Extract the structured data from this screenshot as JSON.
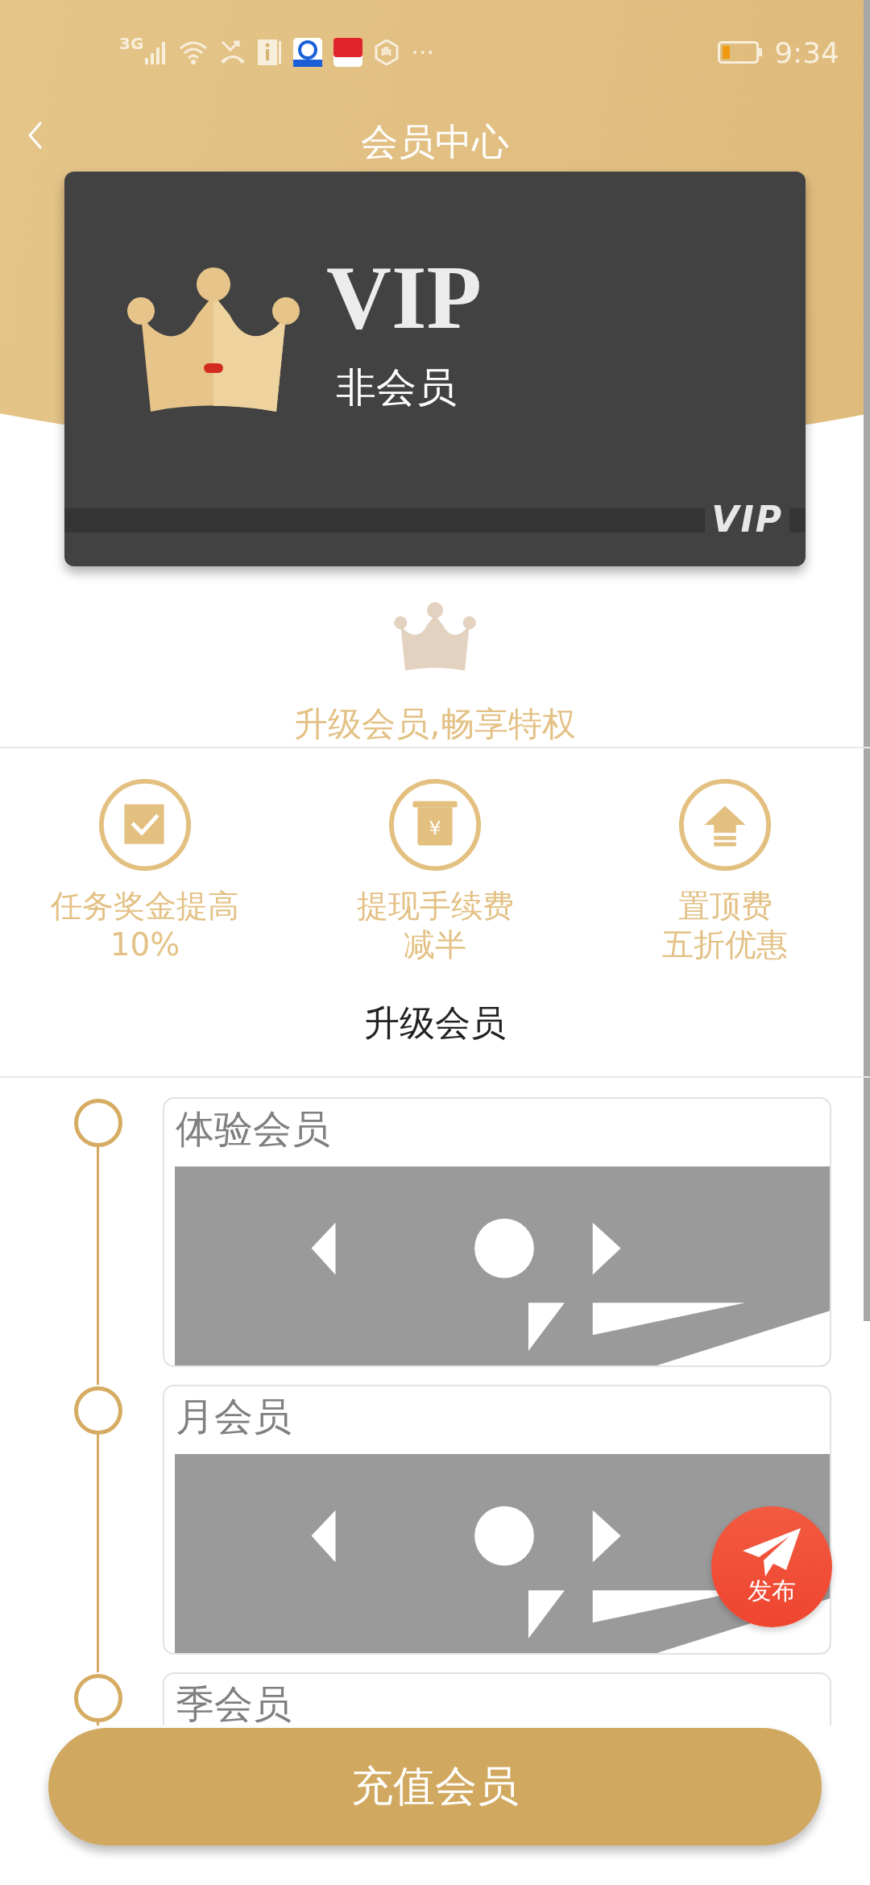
{
  "status_bar": {
    "network": "3G",
    "more": "···",
    "time": "9:34"
  },
  "header": {
    "title": "会员中心"
  },
  "card": {
    "badge": "VIP",
    "status": "非会员",
    "stamp": "VIP"
  },
  "promo": {
    "slogan": "升级会员,畅享特权"
  },
  "benefits": [
    {
      "kind": "check",
      "title": "任务奖金提高",
      "subtitle": "10%"
    },
    {
      "kind": "withdraw",
      "symbol": "¥",
      "title": "提现手续费",
      "subtitle": "减半"
    },
    {
      "kind": "top",
      "title": "置顶费",
      "subtitle": "五折优惠"
    }
  ],
  "section_title": "升级会员",
  "plans": [
    {
      "name": "体验会员"
    },
    {
      "name": "月会员"
    },
    {
      "name": "季会员"
    }
  ],
  "fab": {
    "label": "发布"
  },
  "button": {
    "label": "充值会员"
  }
}
